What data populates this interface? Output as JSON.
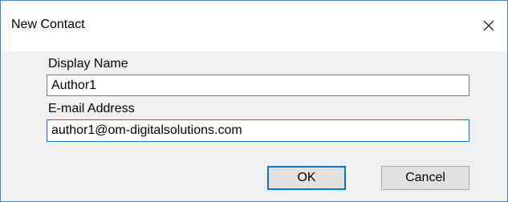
{
  "window": {
    "title": "New Contact",
    "close_icon": "close-icon"
  },
  "form": {
    "display_name_label": "Display Name",
    "display_name_value": "Author1",
    "email_label": "E-mail Address",
    "email_value": "author1@om-digitalsolutions.com"
  },
  "buttons": {
    "ok_label": "OK",
    "cancel_label": "Cancel"
  },
  "colors": {
    "accent": "#0078d7",
    "window_border": "#3a88d4",
    "dialog_bg": "#f0f0f0",
    "button_bg": "#e1e1e1"
  }
}
